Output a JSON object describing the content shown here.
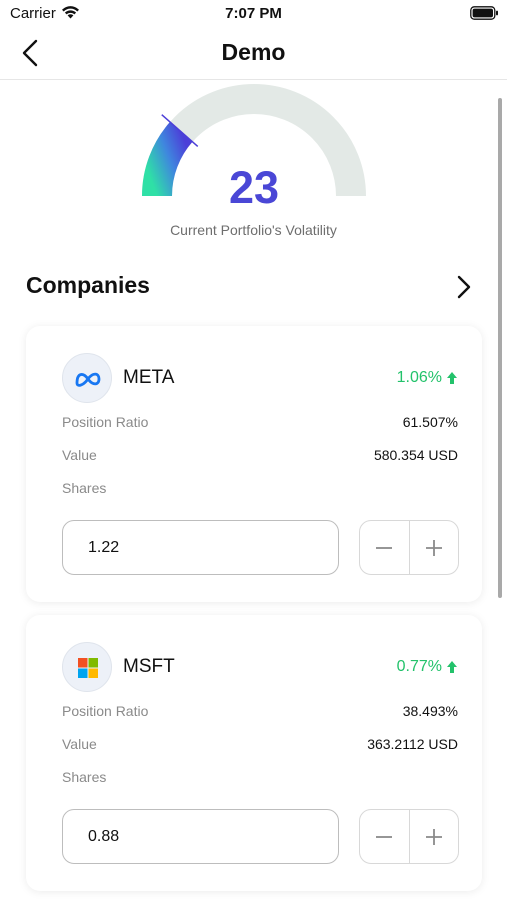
{
  "status_bar": {
    "carrier": "Carrier",
    "time": "7:07 PM"
  },
  "nav": {
    "title": "Demo",
    "back_icon": "chevron-left-icon"
  },
  "gauge": {
    "value": "23",
    "caption": "Current Portfolio's Volatility",
    "fill_fraction": 0.23,
    "colors": {
      "track": "#e3e9e6",
      "gradient_start": "#2fe0a6",
      "gradient_mid": "#3f86de",
      "gradient_end": "#4c3fd8",
      "value": "#4a47d6"
    }
  },
  "companies": {
    "title": "Companies",
    "items": [
      {
        "ticker": "META",
        "change": "1.06%",
        "position_ratio_label": "Position Ratio",
        "position_ratio": "61.507%",
        "value_label": "Value",
        "value": "580.354 USD",
        "shares_label": "Shares",
        "shares": "1.22",
        "logo_icon": "meta-logo-icon"
      },
      {
        "ticker": "MSFT",
        "change": "0.77%",
        "position_ratio_label": "Position Ratio",
        "position_ratio": "38.493%",
        "value_label": "Value",
        "value": "363.2112 USD",
        "shares_label": "Shares",
        "shares": "0.88",
        "logo_icon": "microsoft-logo-icon"
      }
    ]
  },
  "colors": {
    "positive": "#23c26b",
    "accent": "#4a47d6",
    "meta_blue": "#1877f2"
  }
}
